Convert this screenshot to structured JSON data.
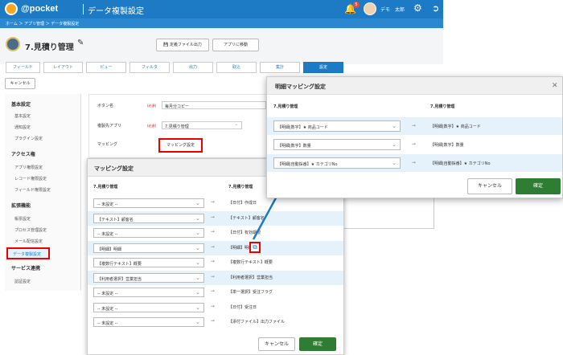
{
  "header": {
    "logo": "@pocket",
    "title": "データ複製設定",
    "notif_count": "5",
    "user": "デモ　太郎"
  },
  "breadcrumb": "ホーム ＞ アプリ管理 ＞ データ複製設定",
  "app": {
    "name": "7.見積り管理"
  },
  "buttons": {
    "def_output": "定義ファイル出力",
    "move_app": "アプリに移動",
    "cancel": "キャンセル"
  },
  "tabs": [
    "フィールド",
    "レイアウト",
    "ビュー",
    "フィルタ",
    "出力",
    "取込",
    "集計",
    "設定"
  ],
  "sidebar": {
    "sections": [
      {
        "title": "基本設定",
        "items": [
          "基本設定",
          "通知設定",
          "プラグイン設定"
        ]
      },
      {
        "title": "アクセス権",
        "items": [
          "アプリ権限設定",
          "レコード権限設定",
          "フィールド権限設定"
        ]
      },
      {
        "title": "拡張機能",
        "items": [
          "帳票設定",
          "プロセス管理設定",
          "メール配信設定",
          "データ複製設定"
        ]
      },
      {
        "title": "サービス連携",
        "items": [
          "認証設定"
        ]
      }
    ]
  },
  "form": {
    "button_name_label": "ボタン名",
    "button_name_value": "毎月分コピー",
    "required": "(必須)",
    "target_app_label": "複製先アプリ",
    "target_app_value": "7.見積り管理",
    "mapping_label": "マッピング",
    "mapping_button": "マッピング設定"
  },
  "mapping_dialog": {
    "title": "マッピング設定",
    "col1": "7.見積り管理",
    "col2": "7.見積り管理",
    "rows": [
      {
        "src": "-- 未設定 --",
        "dst": "【日付】作成日"
      },
      {
        "src": "【テキスト】顧客名",
        "dst": "【テキスト】顧客名"
      },
      {
        "src": "-- 未設定 --",
        "dst": "【日付】有効期限"
      },
      {
        "src": "【明細】明細",
        "dst": "【明細】明細"
      },
      {
        "src": "【複数行テキスト】概要",
        "dst": "【複数行テキスト】概要"
      },
      {
        "src": "【利用者選択】営業担当",
        "dst": "【利用者選択】営業担当"
      },
      {
        "src": "-- 未設定 --",
        "dst": "【単一選択】受注フラグ"
      },
      {
        "src": "-- 未設定 --",
        "dst": "【日付】受注日"
      },
      {
        "src": "-- 未設定 --",
        "dst": "【添付ファイル】出力ファイル"
      }
    ],
    "cancel": "キャンセル",
    "ok": "確定"
  },
  "detail_dialog": {
    "title": "明細マッピング設定",
    "col1": "7.見積り管理",
    "col2": "7.見積り管理",
    "rows": [
      {
        "src": "【明細|数字】★ 商品コード",
        "dst": "【明細|数字】★ 商品コード"
      },
      {
        "src": "【明細|数字】数量",
        "dst": "【明細|数字】数量"
      },
      {
        "src": "【明細|自動採番】★ カテゴリNo",
        "dst": "【明細|自動採番】★ カテゴリNo"
      }
    ],
    "cancel": "キャンセル",
    "ok": "確定"
  },
  "colors": {
    "primary": "#1d7ac4",
    "ok_green": "#2e7d32",
    "highlight_red": "#e00000",
    "row_alt": "#e6f2fb"
  }
}
